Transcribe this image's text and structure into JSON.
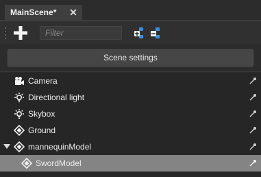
{
  "tab": {
    "title": "MainScene*",
    "close_glyph": "✕"
  },
  "toolbar": {
    "add_icon": "plus-icon",
    "filter_placeholder": "Filter",
    "expand_icon": "expand-all-icon",
    "collapse_icon": "collapse-all-icon"
  },
  "scene_settings_label": "Scene settings",
  "tree": {
    "items": [
      {
        "label": "Camera",
        "icon": "camera-icon",
        "selected": false,
        "expanded": null
      },
      {
        "label": "Directional light",
        "icon": "light-icon",
        "selected": false,
        "expanded": null
      },
      {
        "label": "Skybox",
        "icon": "light-icon",
        "selected": false,
        "expanded": null
      },
      {
        "label": "Ground",
        "icon": "entity-icon",
        "selected": false,
        "expanded": null
      },
      {
        "label": "mannequinModel",
        "icon": "entity-icon",
        "selected": false,
        "expanded": true
      },
      {
        "label": "SwordModel",
        "icon": "entity-icon",
        "selected": true,
        "expanded": null
      }
    ]
  },
  "colors": {
    "selection": "#848484",
    "background": "#262626"
  }
}
